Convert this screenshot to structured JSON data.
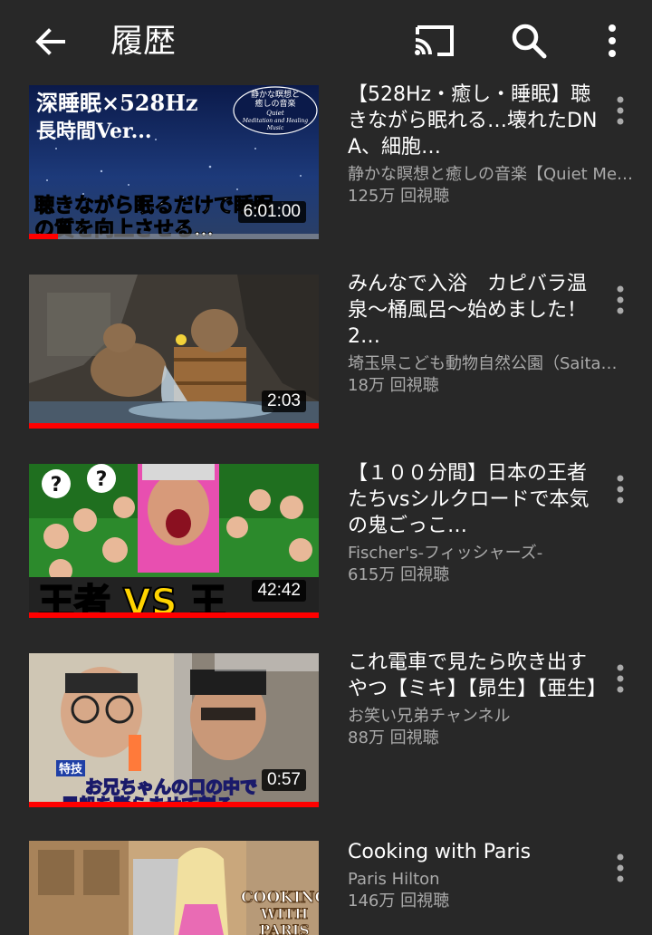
{
  "appbar": {
    "title": "履歴",
    "back_icon": "arrow-left-icon",
    "cast_icon": "cast-icon",
    "search_icon": "search-icon",
    "more_icon": "more-vertical-icon"
  },
  "videos": [
    {
      "title": "【528Hz・癒し・睡眠】聴きながら眠れる…壊れたDNA、細胞…",
      "channel": "静かな瞑想と癒しの音楽【Quiet Me…",
      "views": "125万 回視聴",
      "duration": "6:01:00",
      "watched_fraction": 0.1,
      "thumb_text": {
        "line1": "深睡眠×528Hz",
        "line2": "長時間Ver...",
        "badge1": "静かな瞑想と",
        "badge2": "癒しの音楽",
        "badge3": "Quiet",
        "badge4": "Meditation and Healing",
        "badge5": "Music",
        "line3": "聴きながら眠るだけで睡眠",
        "line4": "の質を向上させる…"
      }
    },
    {
      "title": "みんなで入浴　カピバラ温泉〜桶風呂〜始めました！　2…",
      "channel": "埼玉県こども動物自然公園（Saita…",
      "views": "18万 回視聴",
      "duration": "2:03",
      "watched_fraction": 1.0
    },
    {
      "title": "【１００分間】日本の王者たちvsシルクロードで本気の鬼ごっこ…",
      "channel": "Fischer's-フィッシャーズ-",
      "views": "615万 回視聴",
      "duration": "42:42",
      "watched_fraction": 1.0,
      "thumb_text": {
        "q1": "?",
        "q2": "?",
        "big": "王者 VS 王"
      }
    },
    {
      "title": "これ電車で見たら吹き出すやつ【ミキ】【昴生】【亜生】",
      "channel": "お笑い兄弟チャンネル",
      "views": "88万 回視聴",
      "duration": "0:57",
      "watched_fraction": 1.0,
      "thumb_text": {
        "tag": "特技",
        "caption1": "お兄ちゃんの口の中で",
        "caption2": "風船を膨らませて割る"
      }
    },
    {
      "title": "Cooking with Paris",
      "channel": "Paris Hilton",
      "views": "146万 回視聴",
      "duration": "",
      "watched_fraction": 0,
      "thumb_text": {
        "l1": "COOKING",
        "l2": "WITH",
        "l3": "PARIS"
      }
    }
  ],
  "colors": {
    "background": "#282828",
    "text_primary": "#ffffff",
    "text_secondary": "#aaaaaa",
    "progress": "#ff0000"
  }
}
